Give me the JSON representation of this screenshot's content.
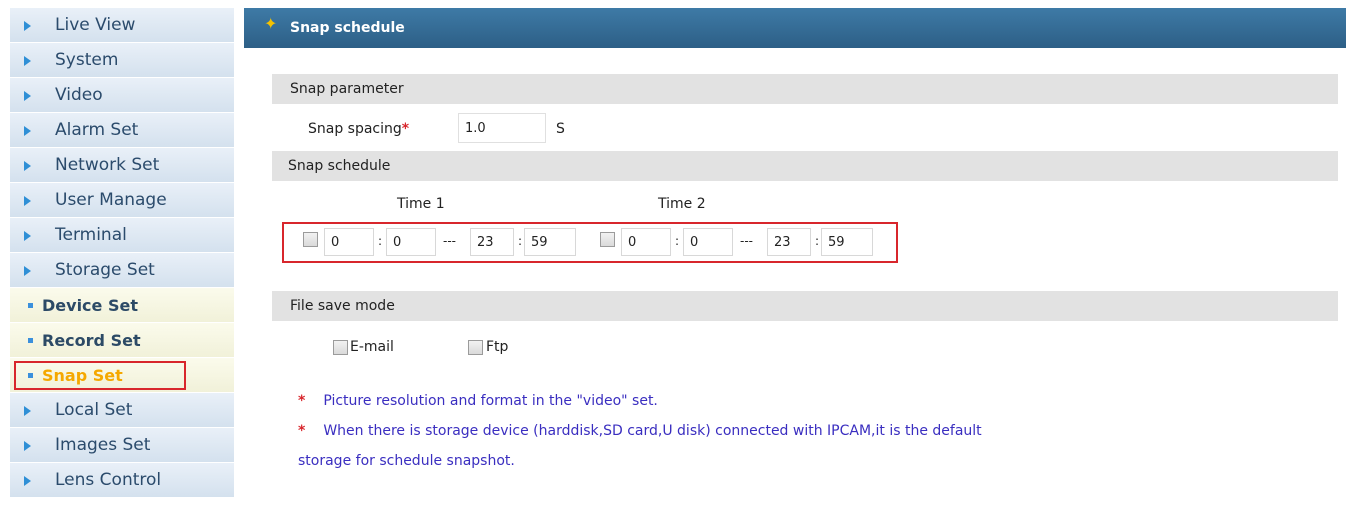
{
  "sidebar": {
    "items": [
      {
        "label": "Live View"
      },
      {
        "label": "System"
      },
      {
        "label": "Video"
      },
      {
        "label": "Alarm Set"
      },
      {
        "label": "Network Set"
      },
      {
        "label": "User Manage"
      },
      {
        "label": "Terminal"
      },
      {
        "label": "Storage Set"
      },
      {
        "label": "Device Set"
      },
      {
        "label": "Record Set"
      },
      {
        "label": "Snap Set"
      },
      {
        "label": "Local Set"
      },
      {
        "label": "Images Set"
      },
      {
        "label": "Lens Control"
      }
    ],
    "active_item": "Snap Set"
  },
  "header": {
    "title": "Snap schedule"
  },
  "snap_parameter": {
    "section_title": "Snap parameter",
    "spacing_label": "Snap spacing",
    "required_mark": "*",
    "spacing_value": "1.0",
    "spacing_unit": "S"
  },
  "snap_schedule": {
    "section_title": "Snap schedule",
    "time1_label": "Time 1",
    "time2_label": "Time 2",
    "separator": ":",
    "range_separator": "---",
    "time1": {
      "enabled": false,
      "start_hour": "0",
      "start_min": "0",
      "end_hour": "23",
      "end_min": "59"
    },
    "time2": {
      "enabled": false,
      "start_hour": "0",
      "start_min": "0",
      "end_hour": "23",
      "end_min": "59"
    }
  },
  "file_save_mode": {
    "section_title": "File save mode",
    "email_label": "E-mail",
    "ftp_label": "Ftp"
  },
  "notes": {
    "mark": "*",
    "note1": "Picture resolution and format in the \"video\" set.",
    "note2_line1": "When there is storage device (harddisk,SD card,U disk) connected with IPCAM,it is the default",
    "note2_line2": "storage for schedule snapshot."
  },
  "colors": {
    "header_bg": "#2d5f86",
    "highlight_border": "#d8262c",
    "note_text": "#3a2ec0",
    "active_item": "#f5a800"
  }
}
